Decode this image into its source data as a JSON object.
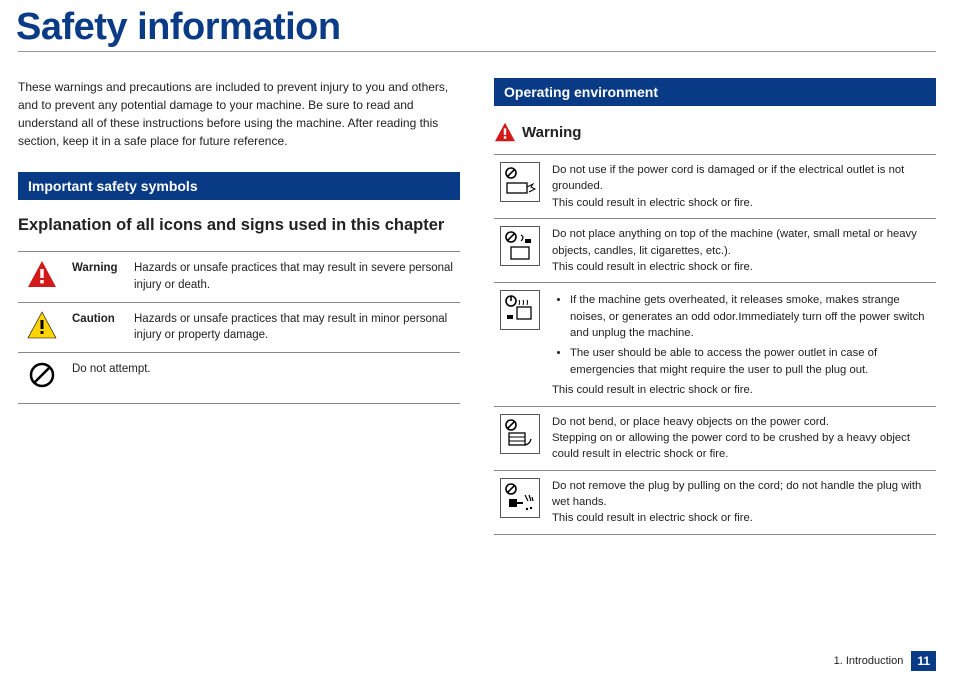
{
  "title": "Safety information",
  "intro": "These warnings and precautions are included to prevent injury to you and others, and to prevent any potential damage to your machine. Be sure to read and understand all of these instructions before using the machine. After reading this section, keep it in a safe place for future reference.",
  "sections": {
    "symbols_heading": "Important safety symbols",
    "symbols_sub": "Explanation of all icons and signs used in this chapter",
    "env_heading": "Operating environment",
    "warning_label": "Warning"
  },
  "symbols": [
    {
      "label": "Warning",
      "desc": "Hazards or unsafe practices that may result in severe personal injury or death."
    },
    {
      "label": "Caution",
      "desc": "Hazards or unsafe practices that may result in minor personal injury or property damage."
    },
    {
      "label": "",
      "desc": "Do not attempt."
    }
  ],
  "warnings": [
    {
      "lines": [
        "Do not use if the power cord is damaged or if the electrical outlet is not grounded.",
        "This could result in electric shock or fire."
      ]
    },
    {
      "lines": [
        "Do not place anything on top of the machine (water, small metal or heavy objects, candles, lit cigarettes, etc.).",
        "This could result in electric shock or fire."
      ]
    },
    {
      "bullets": [
        "If the machine gets overheated, it releases smoke, makes strange noises, or generates an odd odor.Immediately turn off the power switch and unplug the machine.",
        "The user should be able to access the power outlet in case of emergencies that might require the user to pull the plug out."
      ],
      "after": "This could result in electric shock or fire."
    },
    {
      "lines": [
        "Do not bend, or place heavy objects on the power cord.",
        "Stepping on or allowing the power cord to be crushed by a heavy object could result in electric shock or fire."
      ]
    },
    {
      "lines": [
        "Do not remove the plug by pulling on the cord; do not handle the plug with wet hands.",
        "This could result in electric shock or fire."
      ]
    }
  ],
  "footer": {
    "section": "1. Introduction",
    "page": "11"
  },
  "icons": {
    "warning_triangle_red": "warning-red-icon",
    "warning_triangle_yellow": "caution-yellow-icon",
    "prohibit": "prohibit-icon"
  }
}
